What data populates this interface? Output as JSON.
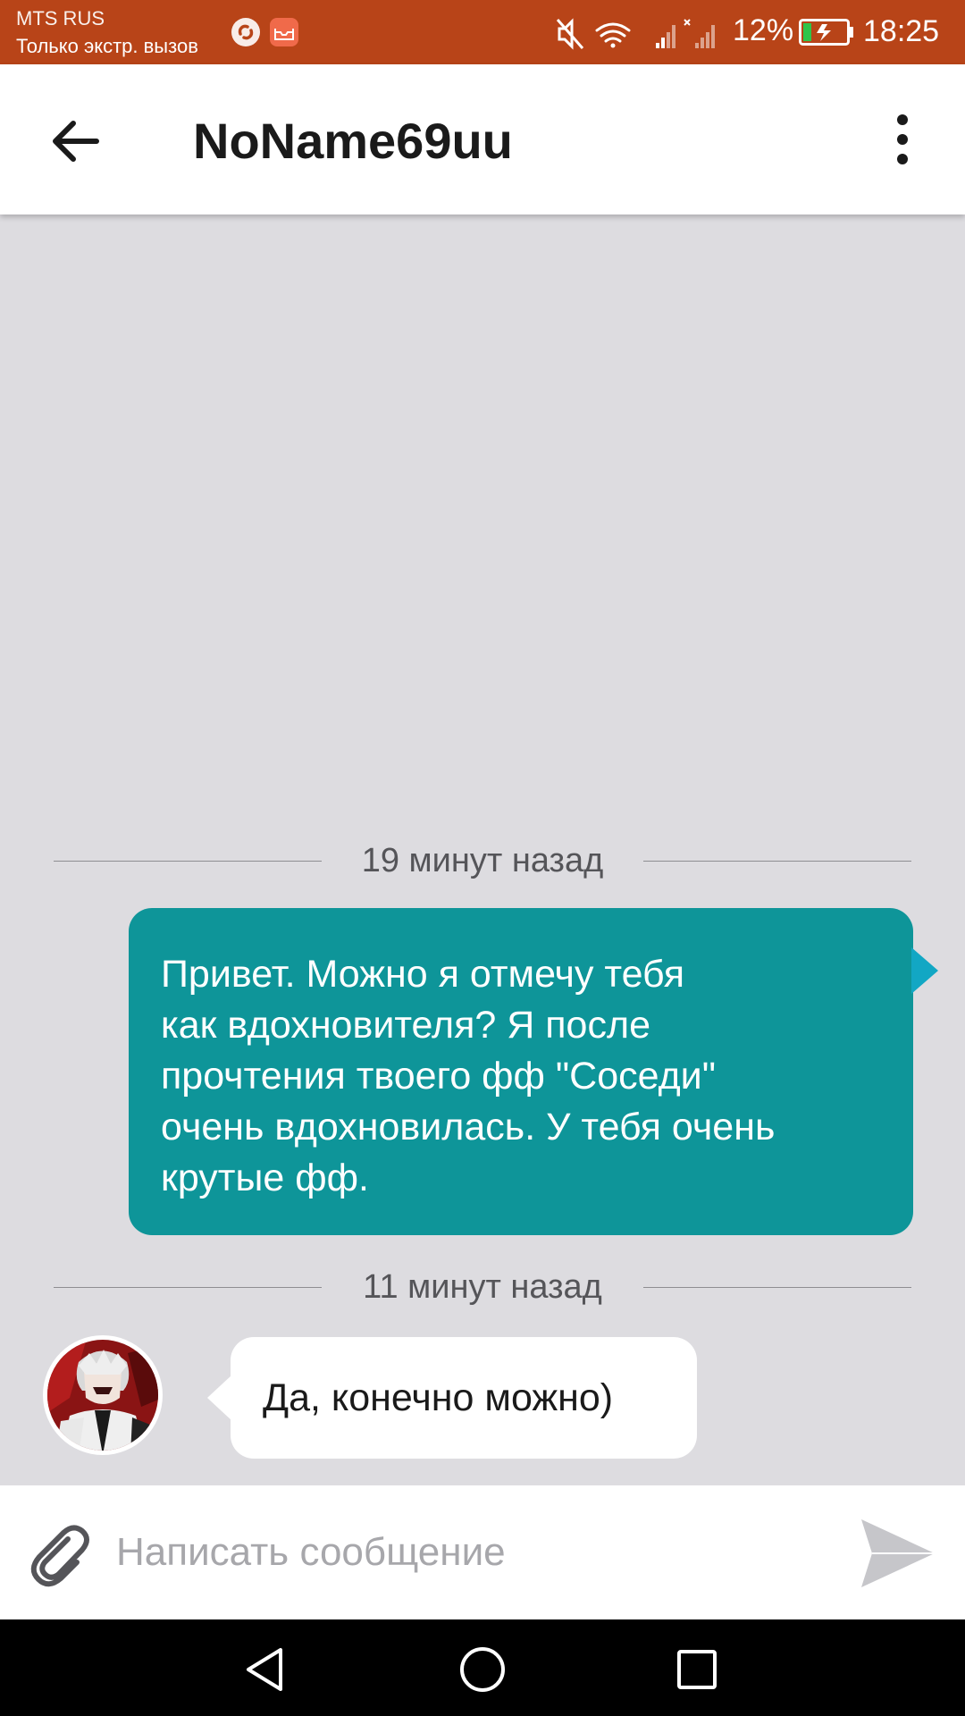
{
  "status_bar": {
    "carrier": "MTS RUS",
    "network_status": "Только экстр. вызов",
    "battery_percent": "12%",
    "time": "18:25",
    "icons": [
      "shazam-icon",
      "mail-app-icon",
      "muted-icon",
      "wifi-icon",
      "signal-icon",
      "signal-no-service-icon",
      "battery-charging-icon"
    ]
  },
  "header": {
    "title": "NoName69uu",
    "icons": [
      "back-arrow-icon",
      "more-vertical-icon"
    ]
  },
  "conversation": {
    "messages": [
      {
        "time_label": "19 минут назад",
        "direction": "outgoing",
        "lines": [
          "Привет. Можно я отмечу тебя",
          "как вдохновителя? Я после",
          "прочтения твоего фф \"Соседи\"",
          "очень вдохновилась. У тебя очень",
          "крутые фф."
        ]
      },
      {
        "time_label": "11 минут назад",
        "direction": "incoming",
        "text": "Да, конечно можно)"
      }
    ]
  },
  "composer": {
    "placeholder": "Написать сообщение",
    "value": "",
    "icons": [
      "paperclip-icon",
      "send-icon"
    ]
  },
  "navigation": {
    "icons": [
      "nav-back-icon",
      "nav-home-icon",
      "nav-recents-icon"
    ]
  },
  "colors": {
    "status_bar": "#b84418",
    "outgoing_bubble": "#0e9599",
    "chat_background": "#dddce0",
    "incoming_bubble": "#ffffff"
  }
}
